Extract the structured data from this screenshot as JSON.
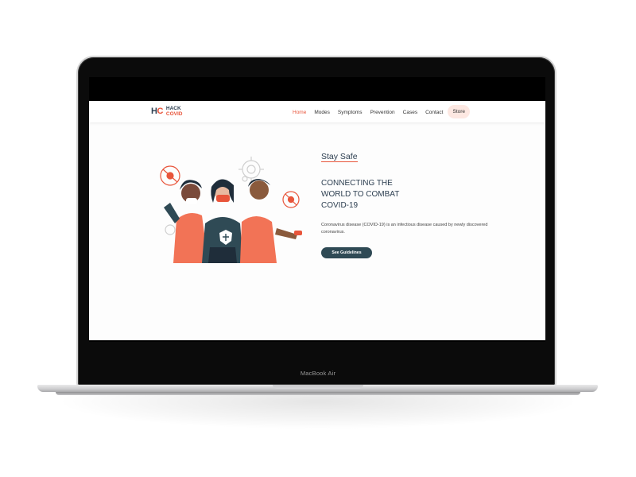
{
  "device": {
    "model_label": "MacBook Air"
  },
  "site": {
    "logo": {
      "mark_h": "H",
      "mark_c": "C",
      "line1": "HACK",
      "line2": "COVID"
    },
    "nav": {
      "items": [
        "Home",
        "Modes",
        "Symptoms",
        "Prevention",
        "Cases",
        "Contact"
      ],
      "active": "Home",
      "store": "Store"
    },
    "hero": {
      "eyebrow": "Stay Safe",
      "headline_lines": [
        "CONNECTING THE",
        "WORLD TO COMBAT",
        "COVID-19"
      ],
      "description": "Coronavirus disease (COVID-19) is an infectious disease caused by newly discovered coronavirus.",
      "cta": "See Guidelines"
    }
  },
  "colors": {
    "accent": "#e8553b",
    "navy": "#2c3e50",
    "button": "#2f4a55",
    "store_bg": "#fde8e2"
  }
}
